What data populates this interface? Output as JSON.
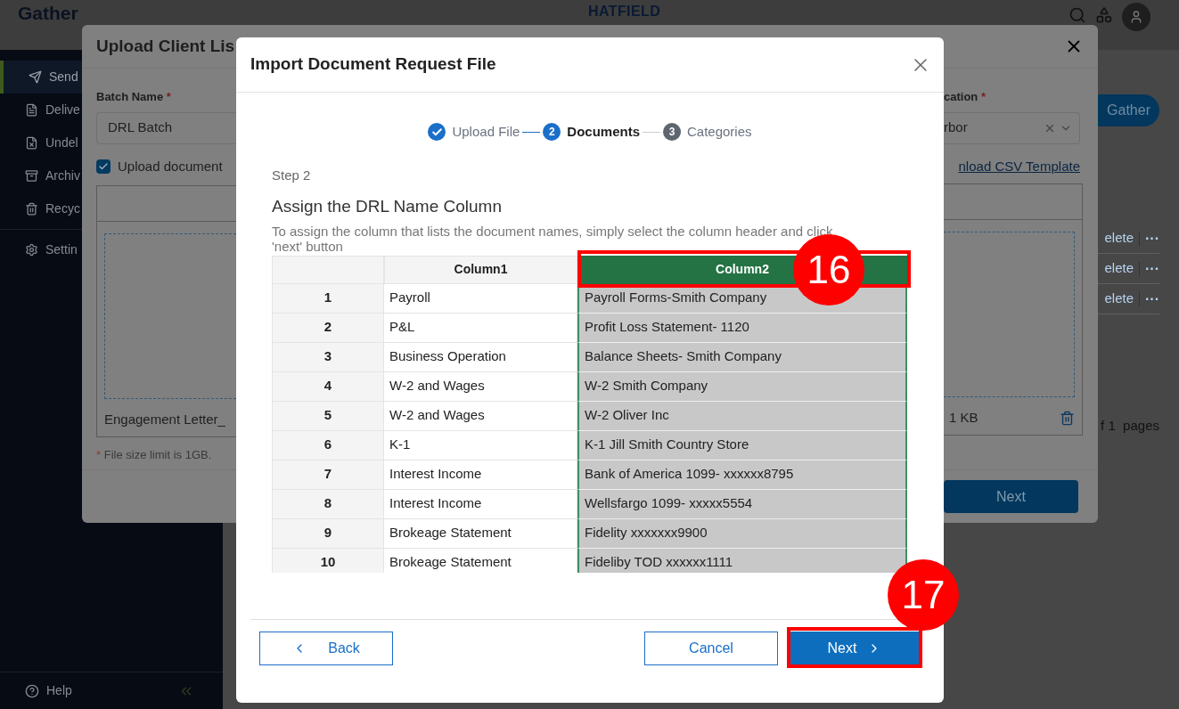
{
  "app": {
    "logo": "Gather",
    "brand": "HATFIELD",
    "sidebar": {
      "items": [
        {
          "label": "Send",
          "selected": true
        },
        {
          "label": "Delive",
          "selected": false
        },
        {
          "label": "Undel",
          "selected": false
        },
        {
          "label": "Archiv",
          "selected": false
        },
        {
          "label": "Recyc",
          "selected": false
        },
        {
          "label": "Settin",
          "selected": false
        }
      ],
      "help": "Help"
    },
    "gather_button": "Gather",
    "row_actions": [
      {
        "link": "elete",
        "more": "···"
      },
      {
        "link": "elete",
        "more": "···"
      },
      {
        "link": "elete",
        "more": "···"
      }
    ],
    "pagination": "f 1  pages"
  },
  "upload_dialog": {
    "title": "Upload Client Lis",
    "batch_label": "Batch Name",
    "batch_required_mark": "*",
    "batch_value": "DRL Batch",
    "upload_checkbox": {
      "label": "Upload document",
      "checked": true
    },
    "location_label": "cation",
    "location_required_mark": "*",
    "location_value": "rbor",
    "template_link": "nload CSV Template",
    "file_name": "Engagement Letter_",
    "file_size": "1 KB",
    "note_mark": "*",
    "note": "File size limit is 1GB.",
    "next": "Next"
  },
  "import_dialog": {
    "title": "Import Document Request File",
    "steps": [
      {
        "label": "Upload File",
        "kind": "done"
      },
      {
        "number": "2",
        "label": "Documents",
        "kind": "current"
      },
      {
        "number": "3",
        "label": "Categories",
        "kind": "pending"
      }
    ],
    "step_label": "Step 2",
    "heading": "Assign the DRL Name Column",
    "description": "To assign the column that lists the document names, simply select the column header and click 'next' button",
    "table": {
      "columns": [
        {
          "label": "Column1",
          "selected": false
        },
        {
          "label": "Column2",
          "selected": true
        }
      ],
      "rows": [
        {
          "index": "1",
          "cells": [
            "Payroll",
            "Payroll Forms-Smith Company"
          ]
        },
        {
          "index": "2",
          "cells": [
            "P&L",
            "Profit Loss Statement- 1120"
          ]
        },
        {
          "index": "3",
          "cells": [
            "Business Operation",
            "Balance Sheets- Smith Company"
          ]
        },
        {
          "index": "4",
          "cells": [
            "W-2 and Wages",
            "W-2 Smith Company"
          ]
        },
        {
          "index": "5",
          "cells": [
            "W-2 and Wages",
            "W-2 Oliver Inc"
          ]
        },
        {
          "index": "6",
          "cells": [
            "K-1",
            "K-1 Jill Smith Country Store"
          ]
        },
        {
          "index": "7",
          "cells": [
            "Interest Income",
            "Bank of America 1099- xxxxxx8795"
          ]
        },
        {
          "index": "8",
          "cells": [
            "Interest Income",
            "Wellsfargo 1099- xxxxx5554"
          ]
        },
        {
          "index": "9",
          "cells": [
            "Brokeage Statement",
            "Fidelity xxxxxxx9900"
          ]
        },
        {
          "index": "10",
          "cells": [
            "Brokeage Statement",
            "Fideliby TOD xxxxxx1111"
          ]
        }
      ]
    },
    "back": "Back",
    "cancel": "Cancel",
    "next": "Next"
  },
  "annotations": [
    {
      "label": "16"
    },
    {
      "label": "17"
    }
  ]
}
